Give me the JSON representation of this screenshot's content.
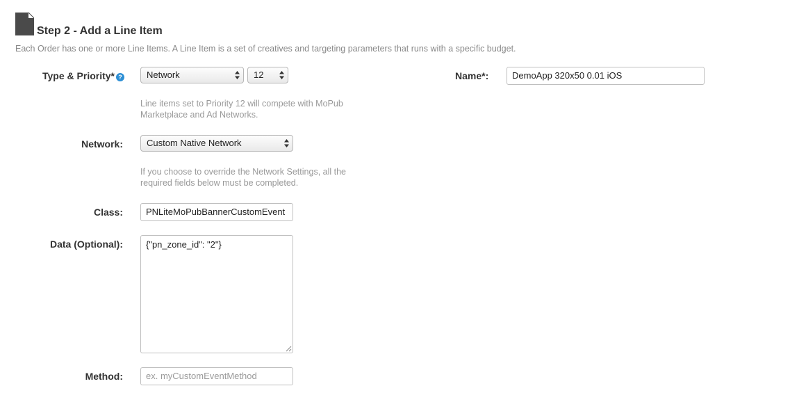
{
  "header": {
    "title": "Step 2 - Add a Line Item",
    "description": "Each Order has one or more Line Items. A Line Item is a set of creatives and targeting parameters that runs with a specific budget."
  },
  "type_priority": {
    "label": "Type & Priority*",
    "help_icon": "?",
    "type_value": "Network",
    "priority_value": "12",
    "help_text_line1": "Line items set to Priority 12 will compete with MoPub",
    "help_text_line2": "Marketplace and Ad Networks."
  },
  "name": {
    "label": "Name*:",
    "value": "DemoApp 320x50 0.01 iOS"
  },
  "network": {
    "label": "Network:",
    "value": "Custom Native Network",
    "help_text_line1": "If you choose to override the Network Settings, all the",
    "help_text_line2": "required fields below must be completed."
  },
  "class": {
    "label": "Class:",
    "value": "PNLiteMoPubBannerCustomEvent"
  },
  "data": {
    "label": "Data (Optional):",
    "value": "{\"pn_zone_id\": \"2\"}"
  },
  "method": {
    "label": "Method:",
    "placeholder": "ex. myCustomEventMethod"
  },
  "icons": {
    "document": "document-icon",
    "help": "help-icon",
    "select_arrows": "select-arrows-icon",
    "resize": "resize-grip-icon"
  },
  "colors": {
    "help_icon_bg": "#2d8fd5",
    "document_icon": "#4a4a4a"
  }
}
